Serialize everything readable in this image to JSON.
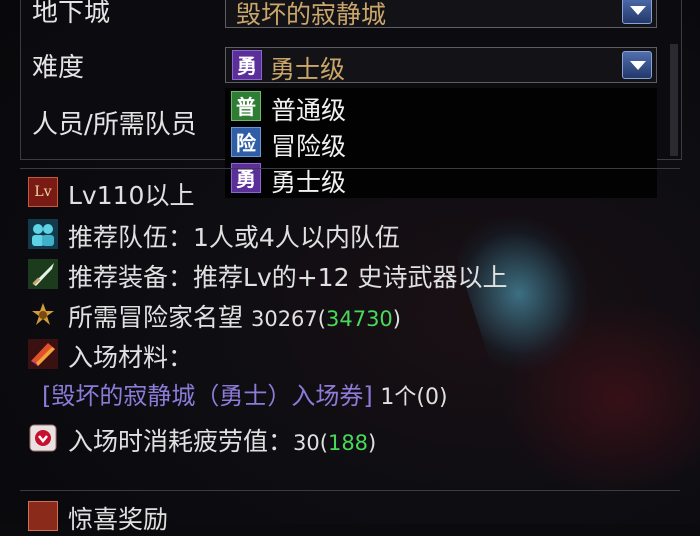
{
  "dungeon": {
    "label": "地下城",
    "selected": "毁坏的寂静城"
  },
  "difficulty": {
    "label": "难度",
    "selected": "勇士级",
    "selected_badge": "勇"
  },
  "members": {
    "label": "人员/所需队员"
  },
  "difficulty_options": [
    {
      "badge": "普",
      "label": "普通级"
    },
    {
      "badge": "险",
      "label": "冒险级"
    },
    {
      "badge": "勇",
      "label": "勇士级"
    }
  ],
  "info": {
    "level": "Lv110以上",
    "level_icon": "Lv",
    "party_label": "推荐队伍：",
    "party_value": "1人或4人以内队伍",
    "equip_label": "推荐装备：",
    "equip_value": "推荐Lv的+12 史诗武器以上",
    "fame_label": "所需冒险家名望",
    "fame_value": "30267",
    "fame_current": "34730",
    "material_label": "入场材料：",
    "material_item": "[毁坏的寂静城（勇士）入场券]",
    "material_count": "1个(0)",
    "fatigue_label": "入场时消耗疲劳值：",
    "fatigue_value": "30",
    "fatigue_current": "188"
  },
  "reward": {
    "label": "惊喜奖励"
  },
  "colors": {
    "warrior": "#5b2f9a",
    "normal": "#2f7d34",
    "adventure": "#2f5ea7",
    "highlight_green": "#48d95a",
    "item_purple": "#8c7bd8"
  }
}
